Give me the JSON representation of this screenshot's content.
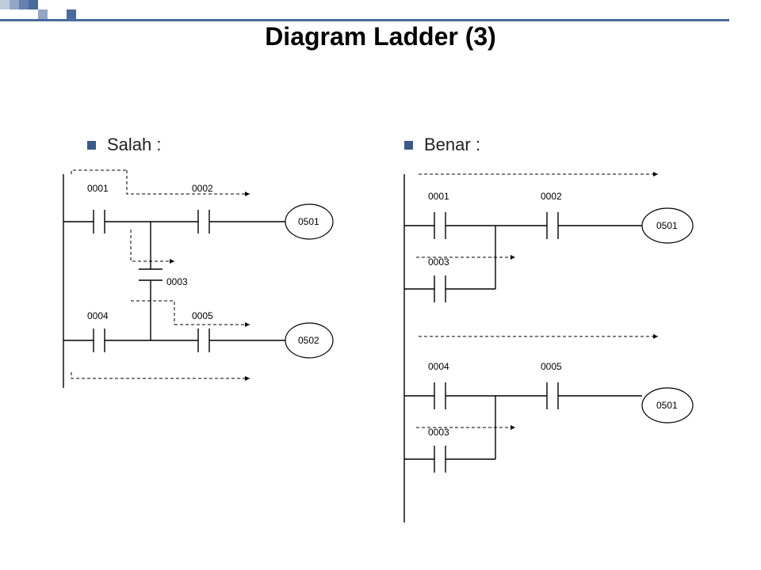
{
  "title": "Diagram Ladder (3)",
  "left": {
    "heading": "Salah :",
    "labels": {
      "c0001": "0001",
      "c0002": "0002",
      "c0003": "0003",
      "c0004": "0004",
      "c0005": "0005",
      "o0501": "0501",
      "o0502": "0502"
    }
  },
  "right": {
    "heading": "Benar :",
    "labels": {
      "c0001": "0001",
      "c0002": "0002",
      "c0003a": "0003",
      "c0004": "0004",
      "c0005": "0005",
      "c0003b": "0003",
      "o0501a": "0501",
      "o0501b": "0501"
    }
  }
}
